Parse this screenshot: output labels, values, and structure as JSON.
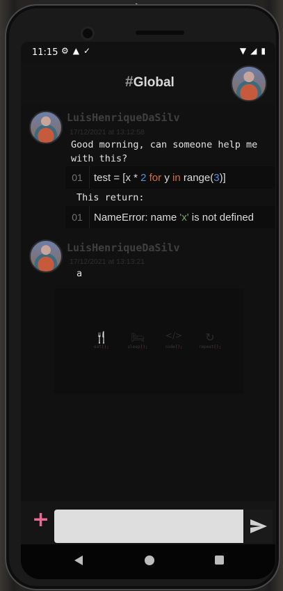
{
  "status_bar": {
    "time": "11:15",
    "left_icons": [
      "gear-icon",
      "android-icon",
      "check-icon"
    ],
    "right_icons": [
      "wifi-icon",
      "signal-icon",
      "battery-icon"
    ]
  },
  "header": {
    "hash": "#",
    "title": "Global"
  },
  "messages": [
    {
      "author": "LuisHenriqueDaSilv",
      "timestamp": "17/12/2021 at 13:12:58",
      "text": "Good morning, can someone help me with this?",
      "code1": {
        "line": "01",
        "parts": [
          "test = [x * ",
          "2",
          " ",
          "for",
          " y ",
          "in",
          " range(",
          "3",
          ")]"
        ]
      },
      "text2": "This return:",
      "code2": {
        "line": "01",
        "parts": [
          "NameError: name ",
          "'x'",
          " is not defined"
        ]
      }
    },
    {
      "author": "LuisHenriqueDaSilv",
      "timestamp": "17/12/2021 at 13:13:21",
      "text": "a",
      "image": {
        "items": [
          {
            "icon": "fork-knife-icon",
            "glyph": "🍴",
            "label": "eat",
            "suffix": "();"
          },
          {
            "icon": "bed-icon",
            "glyph": "🛏",
            "label": "sleep",
            "suffix": "();"
          },
          {
            "icon": "code-icon",
            "glyph": "</>",
            "label": "code",
            "suffix": "();"
          },
          {
            "icon": "refresh-icon",
            "glyph": "↻",
            "label": "repeat",
            "suffix": "();"
          }
        ]
      }
    }
  ],
  "input": {
    "value": "",
    "placeholder": ""
  },
  "colors": {
    "accent": "#e76a92",
    "background": "#111112"
  }
}
